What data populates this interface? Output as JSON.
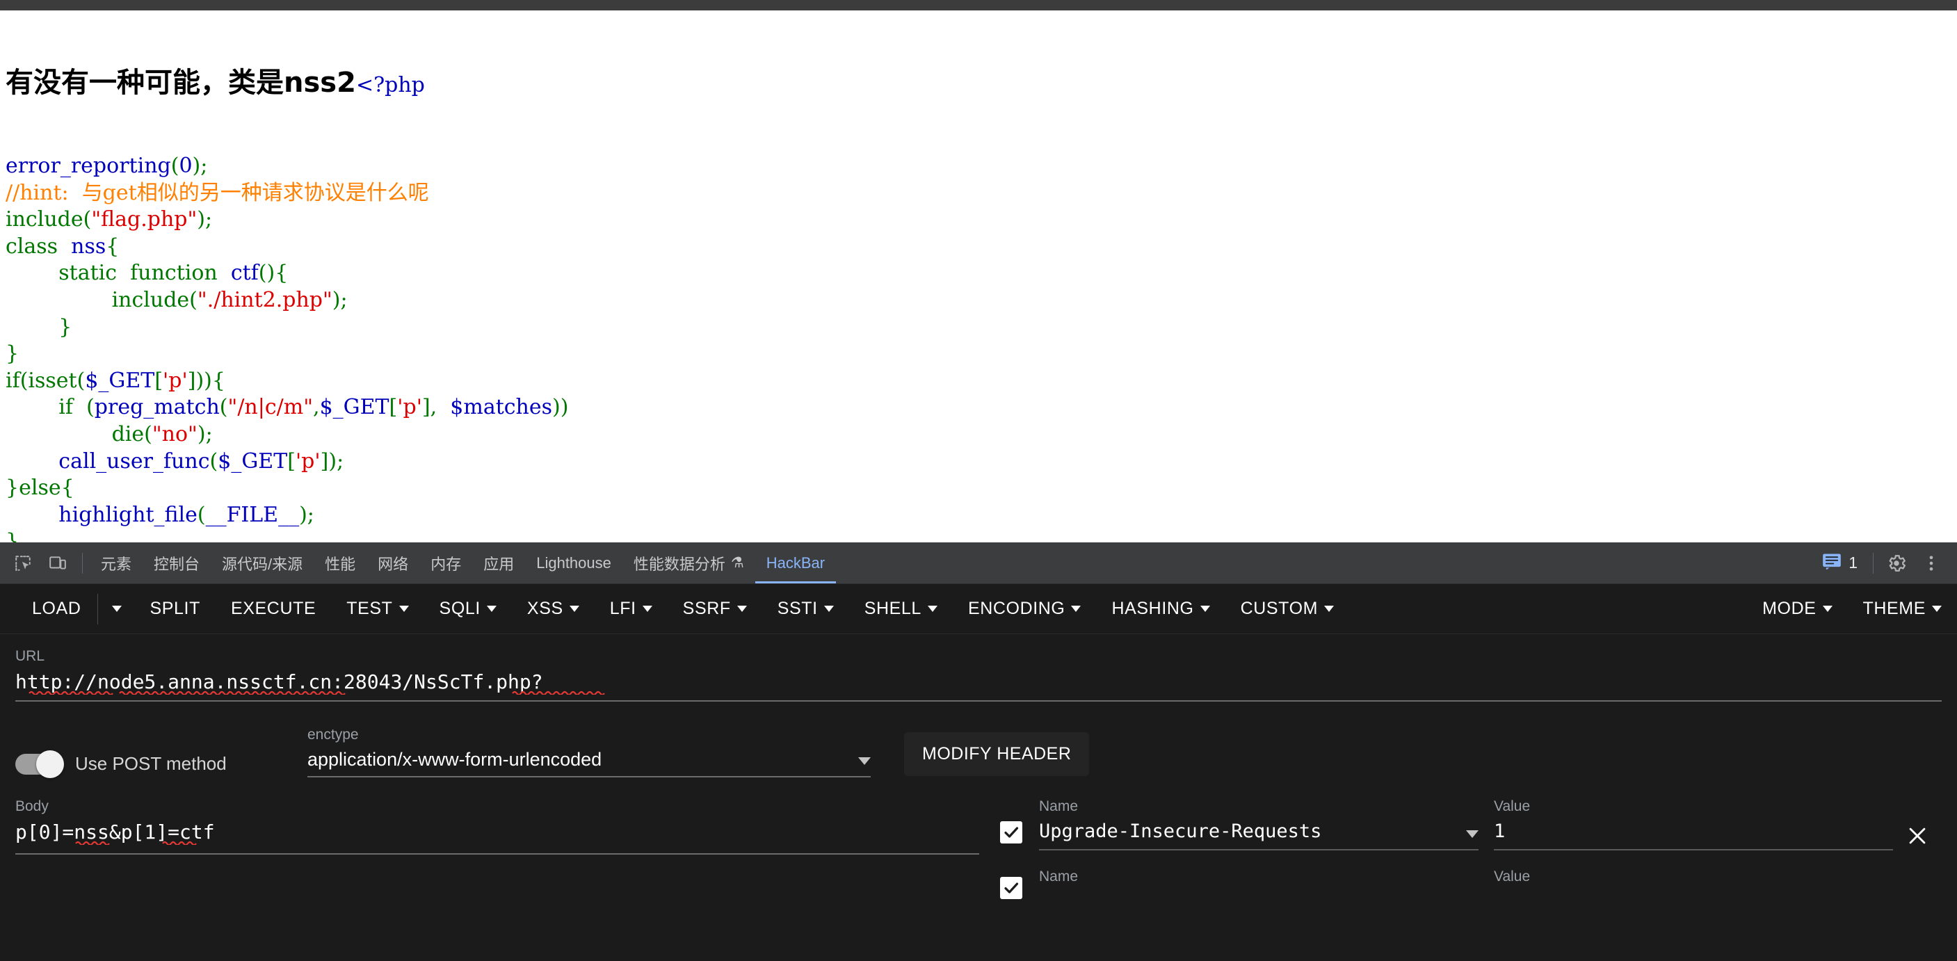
{
  "page": {
    "heading": "有没有一种可能，类是nss2",
    "php_tag": "<?php",
    "code_lines": [
      [
        {
          "t": "error_reporting",
          "c": "kw"
        },
        {
          "t": "(",
          "c": "def"
        },
        {
          "t": "0",
          "c": "kw"
        },
        {
          "t": ")",
          "c": "def"
        },
        {
          "t": ";",
          "c": "def"
        }
      ],
      [
        {
          "t": "//hint:  与get相似的另一种请求协议是什么呢",
          "c": "cmt"
        }
      ],
      [
        {
          "t": "include",
          "c": "def"
        },
        {
          "t": "(",
          "c": "def"
        },
        {
          "t": "\"flag.php\"",
          "c": "str"
        },
        {
          "t": ")",
          "c": "def"
        },
        {
          "t": ";",
          "c": "def"
        }
      ],
      [
        {
          "t": "class  ",
          "c": "def"
        },
        {
          "t": "nss",
          "c": "kw"
        },
        {
          "t": "{",
          "c": "def"
        }
      ],
      [
        {
          "t": "        static  function  ",
          "c": "def"
        },
        {
          "t": "ctf",
          "c": "kw"
        },
        {
          "t": "(",
          "c": "def"
        },
        {
          "t": ")",
          "c": "def"
        },
        {
          "t": "{",
          "c": "def"
        }
      ],
      [
        {
          "t": "                include",
          "c": "def"
        },
        {
          "t": "(",
          "c": "def"
        },
        {
          "t": "\"./hint2.php\"",
          "c": "str"
        },
        {
          "t": ")",
          "c": "def"
        },
        {
          "t": ";",
          "c": "def"
        }
      ],
      [
        {
          "t": "        }",
          "c": "def"
        }
      ],
      [
        {
          "t": "}",
          "c": "def"
        }
      ],
      [
        {
          "t": "if",
          "c": "def"
        },
        {
          "t": "(",
          "c": "def"
        },
        {
          "t": "isset",
          "c": "def"
        },
        {
          "t": "(",
          "c": "def"
        },
        {
          "t": "$_GET",
          "c": "kw"
        },
        {
          "t": "[",
          "c": "def"
        },
        {
          "t": "'p'",
          "c": "str"
        },
        {
          "t": "]",
          "c": "def"
        },
        {
          "t": ")",
          "c": "def"
        },
        {
          "t": ")",
          "c": "def"
        },
        {
          "t": "{",
          "c": "def"
        }
      ],
      [
        {
          "t": "        if  ",
          "c": "def"
        },
        {
          "t": "(",
          "c": "def"
        },
        {
          "t": "preg_match",
          "c": "kw"
        },
        {
          "t": "(",
          "c": "def"
        },
        {
          "t": "\"/n|c/m\"",
          "c": "str"
        },
        {
          "t": ",",
          "c": "def"
        },
        {
          "t": "$_GET",
          "c": "kw"
        },
        {
          "t": "[",
          "c": "def"
        },
        {
          "t": "'p'",
          "c": "str"
        },
        {
          "t": "]",
          "c": "def"
        },
        {
          "t": ",  ",
          "c": "def"
        },
        {
          "t": "$matches",
          "c": "kw"
        },
        {
          "t": ")",
          "c": "def"
        },
        {
          "t": ")",
          "c": "def"
        }
      ],
      [
        {
          "t": "                die",
          "c": "def"
        },
        {
          "t": "(",
          "c": "def"
        },
        {
          "t": "\"no\"",
          "c": "str"
        },
        {
          "t": ")",
          "c": "def"
        },
        {
          "t": ";",
          "c": "def"
        }
      ],
      [
        {
          "t": "        call_user_func",
          "c": "kw"
        },
        {
          "t": "(",
          "c": "def"
        },
        {
          "t": "$_GET",
          "c": "kw"
        },
        {
          "t": "[",
          "c": "def"
        },
        {
          "t": "'p'",
          "c": "str"
        },
        {
          "t": "]",
          "c": "def"
        },
        {
          "t": ")",
          "c": "def"
        },
        {
          "t": ";",
          "c": "def"
        }
      ],
      [
        {
          "t": "}",
          "c": "def"
        },
        {
          "t": "else",
          "c": "def"
        },
        {
          "t": "{",
          "c": "def"
        }
      ],
      [
        {
          "t": "        highlight_file",
          "c": "kw"
        },
        {
          "t": "(",
          "c": "def"
        },
        {
          "t": "__FILE__",
          "c": "kw"
        },
        {
          "t": ")",
          "c": "def"
        },
        {
          "t": ";",
          "c": "def"
        }
      ],
      [
        {
          "t": "}",
          "c": "def"
        }
      ]
    ]
  },
  "devtools": {
    "inspect_icon": "inspect-element-icon",
    "device_icon": "device-toolbar-icon",
    "tabs": [
      {
        "label": "元素",
        "active": false
      },
      {
        "label": "控制台",
        "active": false
      },
      {
        "label": "源代码/来源",
        "active": false
      },
      {
        "label": "性能",
        "active": false
      },
      {
        "label": "网络",
        "active": false
      },
      {
        "label": "内存",
        "active": false
      },
      {
        "label": "应用",
        "active": false
      },
      {
        "label": "Lighthouse",
        "active": false
      },
      {
        "label": "性能数据分析",
        "active": false,
        "flask": "⚗"
      },
      {
        "label": "HackBar",
        "active": true
      }
    ],
    "message_count": "1",
    "settings_icon": "gear-icon",
    "more_icon": "more-vertical-icon",
    "message_icon": "message-icon"
  },
  "hackbar": {
    "toolbar": [
      {
        "label": "LOAD",
        "caret": false
      },
      {
        "label": "",
        "caret": true,
        "caret_only": true
      },
      {
        "label": "SPLIT",
        "caret": false
      },
      {
        "label": "EXECUTE",
        "caret": false
      },
      {
        "label": "TEST",
        "caret": true
      },
      {
        "label": "SQLI",
        "caret": true
      },
      {
        "label": "XSS",
        "caret": true
      },
      {
        "label": "LFI",
        "caret": true
      },
      {
        "label": "SSRF",
        "caret": true
      },
      {
        "label": "SSTI",
        "caret": true
      },
      {
        "label": "SHELL",
        "caret": true
      },
      {
        "label": "ENCODING",
        "caret": true
      },
      {
        "label": "HASHING",
        "caret": true
      },
      {
        "label": "CUSTOM",
        "caret": true
      }
    ],
    "toolbar_right": [
      {
        "label": "MODE",
        "caret": true
      },
      {
        "label": "THEME",
        "caret": true
      }
    ],
    "url": {
      "label": "URL",
      "value": "http://node5.anna.nssctf.cn:28043/NsScTf.php?"
    },
    "post_toggle": {
      "label": "Use POST method",
      "enabled": true
    },
    "enctype": {
      "label": "enctype",
      "value": "application/x-www-form-urlencoded"
    },
    "modify_header_button": "MODIFY HEADER",
    "body": {
      "label": "Body",
      "value": "p[0]=nss&p[1]=ctf"
    },
    "headers": {
      "name_label": "Name",
      "value_label": "Value",
      "rows": [
        {
          "checked": true,
          "name": "Upgrade-Insecure-Requests",
          "value": "1"
        },
        {
          "checked": true,
          "name": "",
          "value": ""
        }
      ]
    }
  },
  "colors": {
    "accent": "#8ab4f8",
    "devtools_bg": "#202124",
    "hackbar_bg": "#1b1b1b",
    "php_keyword": "#0000BB",
    "php_default": "#007700",
    "php_string": "#DD0000",
    "php_comment": "#FF8000"
  }
}
